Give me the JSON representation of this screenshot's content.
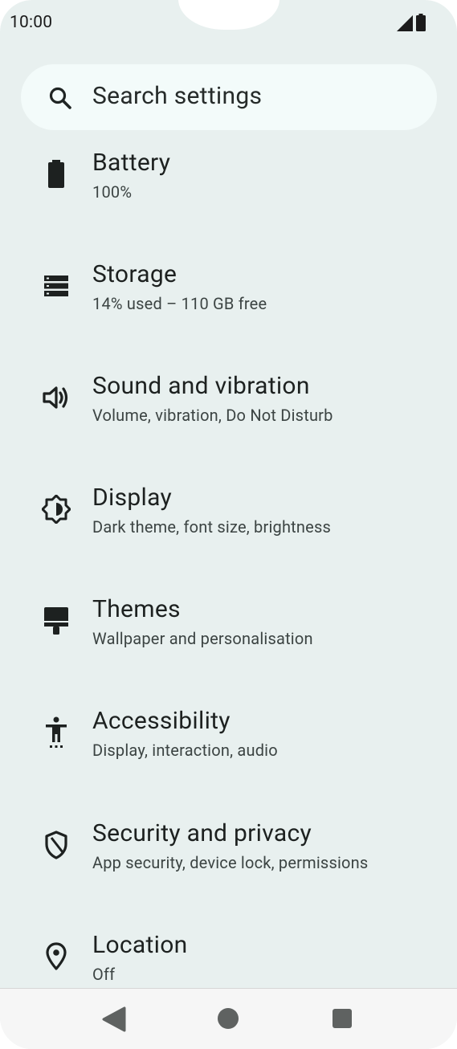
{
  "status_bar": {
    "time": "10:00",
    "icons": [
      "signal-icon",
      "battery-icon"
    ]
  },
  "search": {
    "placeholder": "Search settings",
    "icon": "search-icon"
  },
  "settings": [
    {
      "title": "Battery",
      "subtitle": "100%",
      "icon": "battery-icon"
    },
    {
      "title": "Storage",
      "subtitle": "14% used – 110 GB free",
      "icon": "storage-icon"
    },
    {
      "title": "Sound and vibration",
      "subtitle": "Volume, vibration, Do Not Disturb",
      "icon": "volume-icon"
    },
    {
      "title": "Display",
      "subtitle": "Dark theme, font size, brightness",
      "icon": "brightness-icon"
    },
    {
      "title": "Themes",
      "subtitle": "Wallpaper and personalisation",
      "icon": "paint-roller-icon"
    },
    {
      "title": "Accessibility",
      "subtitle": "Display, interaction, audio",
      "icon": "accessibility-icon"
    },
    {
      "title": "Security and privacy",
      "subtitle": "App security, device lock, permissions",
      "icon": "shield-icon"
    },
    {
      "title": "Location",
      "subtitle": "Off",
      "icon": "location-pin-icon"
    }
  ],
  "nav_bar": {
    "buttons": [
      "back-icon",
      "home-icon",
      "recents-icon"
    ]
  },
  "colors": {
    "background": "#e8f0ef",
    "search_background": "#f3fbfa",
    "text_primary": "#1d2120",
    "text_secondary": "#3c4443"
  }
}
